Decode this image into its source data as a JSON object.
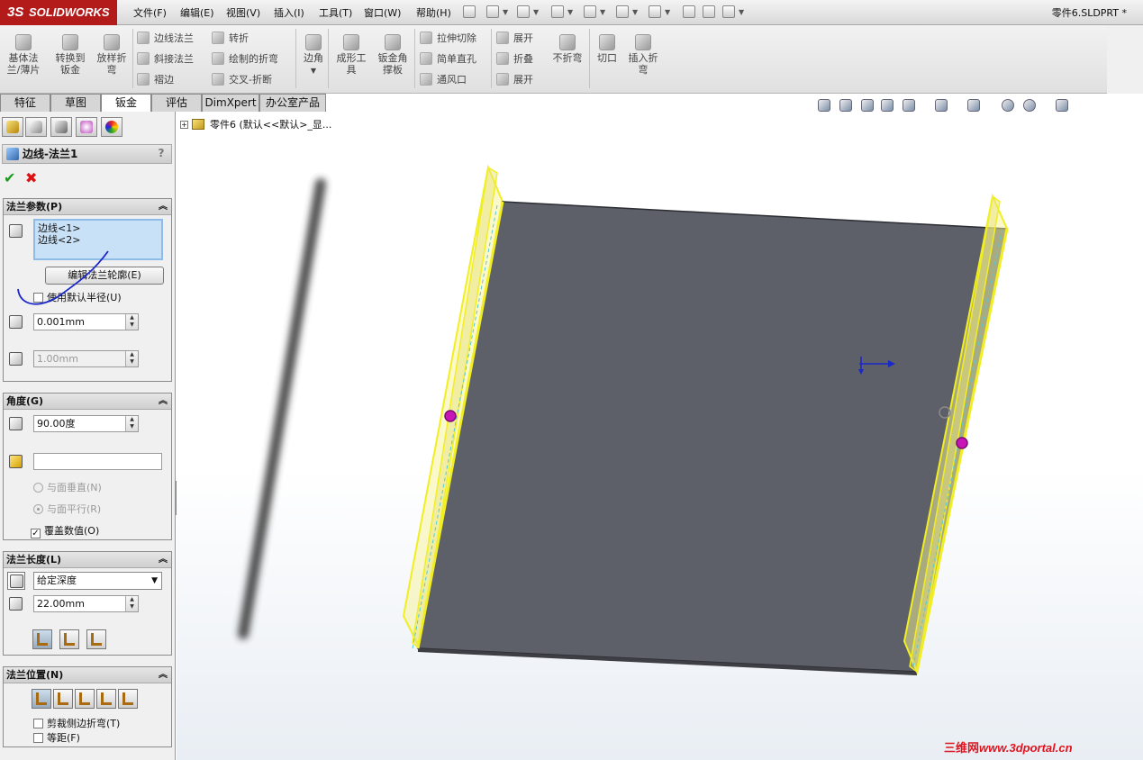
{
  "app": {
    "logo_prefix": "3S",
    "logo_text": "SOLIDWORKS",
    "document_title": "零件6.SLDPRT *"
  },
  "menu": [
    "文件(F)",
    "编辑(E)",
    "视图(V)",
    "插入(I)",
    "工具(T)",
    "窗口(W)",
    "帮助(H)"
  ],
  "ribbon": {
    "big_buttons": [
      {
        "label_1": "基体法",
        "label_2": "兰/薄片",
        "icon": "base-flange-icon"
      },
      {
        "label_1": "转换到",
        "label_2": "钣金",
        "icon": "convert-to-sheet-metal-icon"
      },
      {
        "label_1": "放样折",
        "label_2": "弯",
        "icon": "lofted-bend-icon"
      }
    ],
    "col1": [
      "边线法兰",
      "斜接法兰",
      "褶边"
    ],
    "col2": [
      "转折",
      "绘制的折弯",
      "交叉-折断"
    ],
    "corner": "边角",
    "forming_tool_1": "成形工",
    "forming_tool_2": "具",
    "gusset_1": "钣金角",
    "gusset_2": "撑板",
    "col3": [
      "拉伸切除",
      "简单直孔",
      "通风口"
    ],
    "col4": [
      "展开",
      "折叠",
      "展开"
    ],
    "no_bends": "不折弯",
    "rip": "切口",
    "insert_bends_1": "插入折",
    "insert_bends_2": "弯"
  },
  "tabs": [
    "特征",
    "草图",
    "钣金",
    "评估",
    "DimXpert",
    "办公室产品"
  ],
  "active_tab": "钣金",
  "property_manager": {
    "title": "边线-法兰1",
    "help": "?",
    "groups": {
      "flange_params": {
        "title": "法兰参数(P)",
        "edges": [
          "边线<1>",
          "边线<2>"
        ],
        "edit_profile_button": "编辑法兰轮廓(E)",
        "use_default_radius_label": "使用默认半径(U)",
        "use_default_radius": false,
        "bend_radius": "0.001mm",
        "gap": "1.00mm"
      },
      "angle": {
        "title": "角度(G)",
        "angle_value": "90.00度",
        "reference_face": "",
        "perpendicular_label": "与面垂直(N)",
        "parallel_label": "与面平行(R)",
        "override_label": "覆盖数值(O)",
        "override": true
      },
      "flange_length": {
        "title": "法兰长度(L)",
        "end_condition": "给定深度",
        "length": "22.00mm"
      },
      "flange_position": {
        "title": "法兰位置(N)",
        "trim_side_bends_label": "剪裁侧边折弯(T)",
        "offset_label": "等距(F)"
      }
    }
  },
  "feature_tree": {
    "root_label": "零件6  (默认<<默认>_显..."
  },
  "watermark": {
    "cn": "三维网",
    "url": "www.3dportal.cn"
  }
}
